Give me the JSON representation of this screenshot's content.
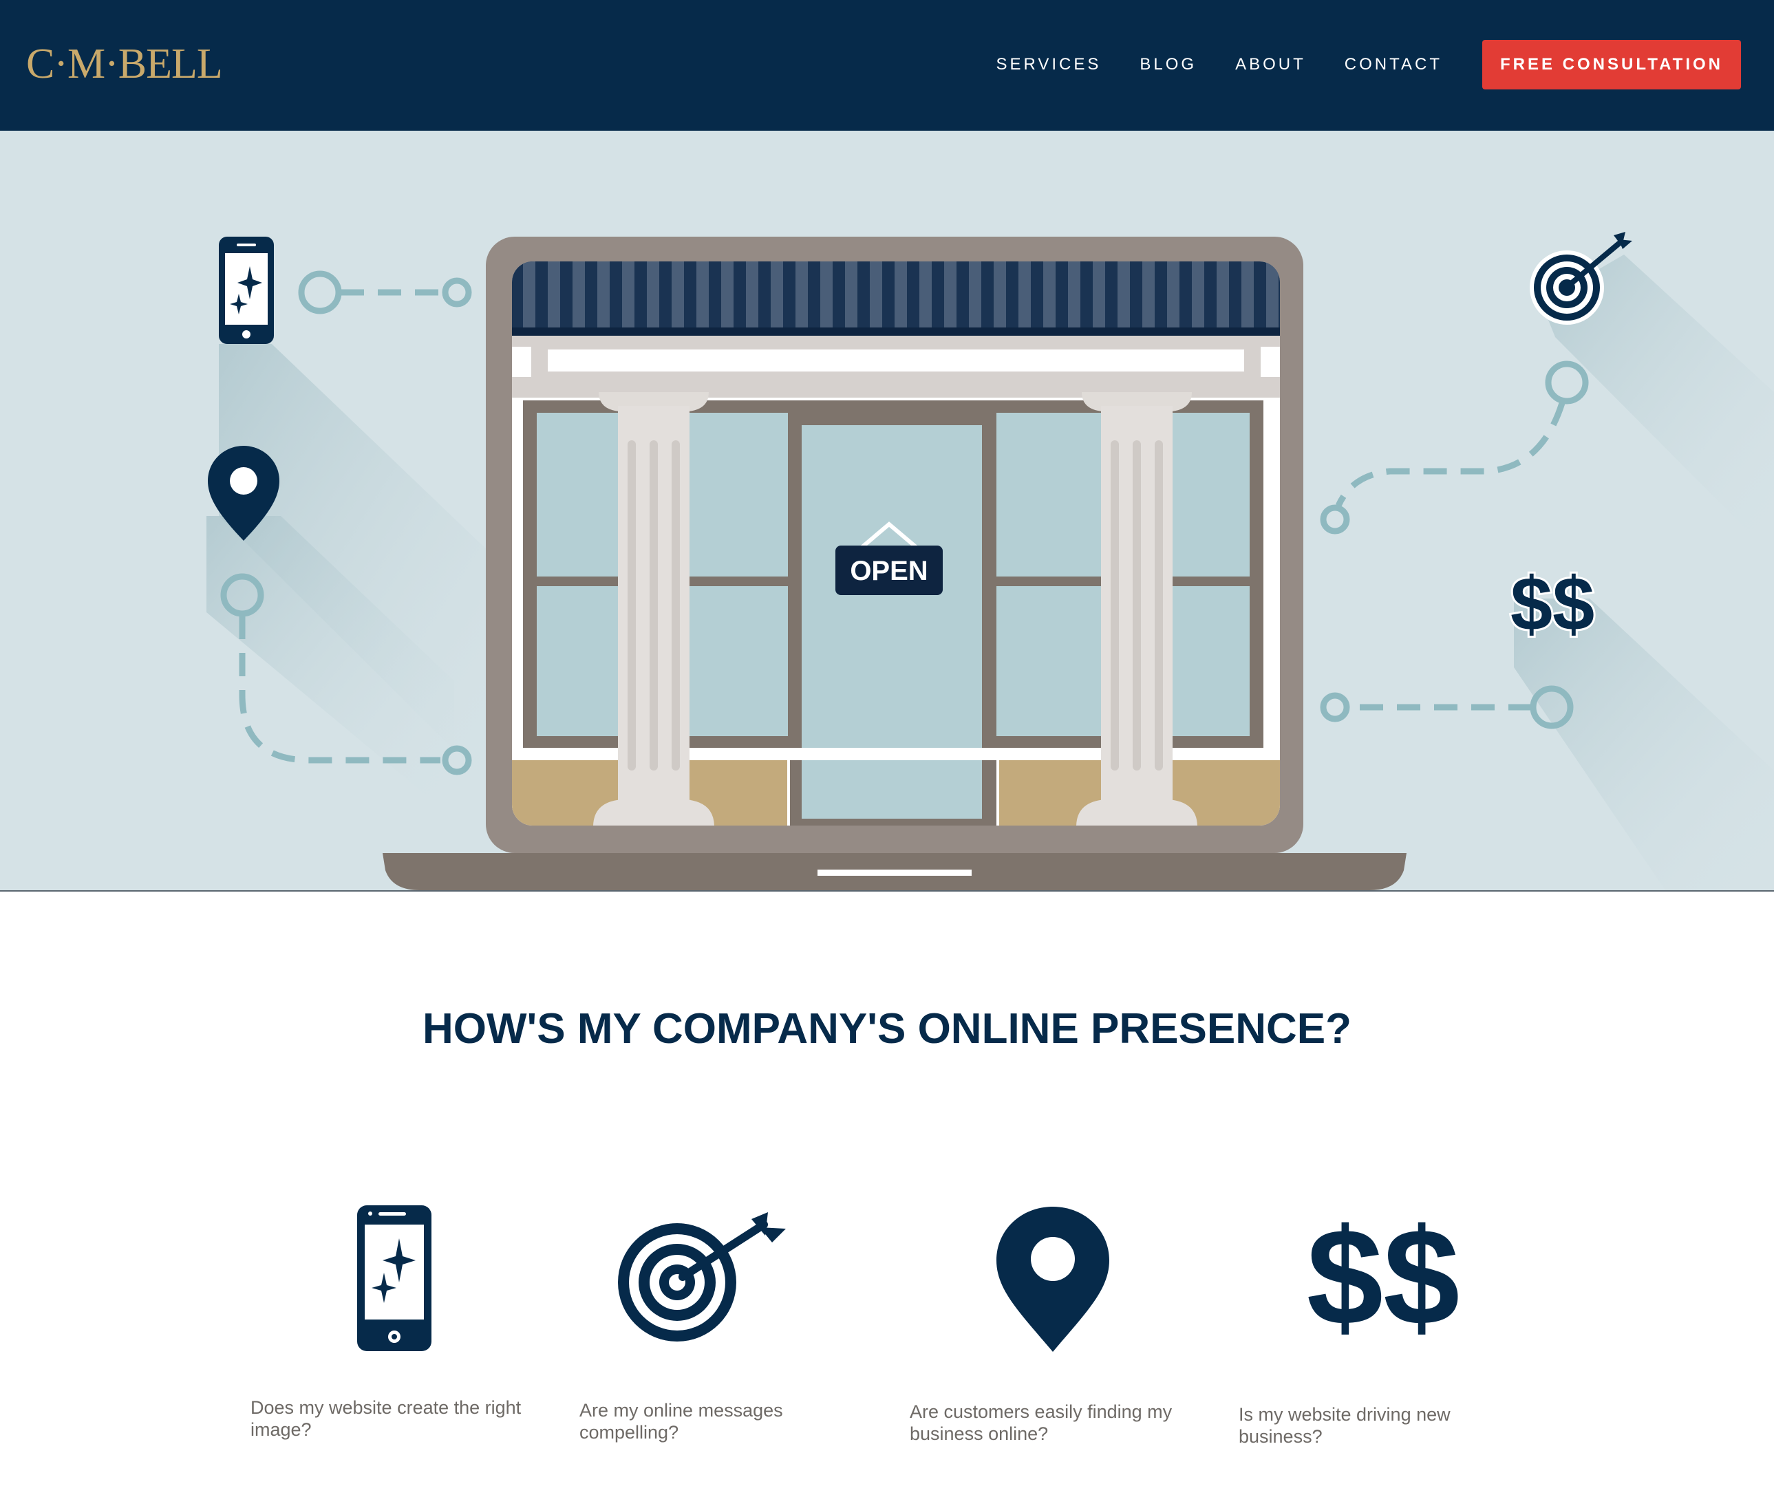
{
  "header": {
    "logo": "C·M·BELL",
    "nav": [
      {
        "label": "SERVICES"
      },
      {
        "label": "BLOG"
      },
      {
        "label": "ABOUT"
      },
      {
        "label": "CONTACT"
      }
    ],
    "cta_label": "FREE CONSULTATION"
  },
  "hero": {
    "sign_text": "OPEN",
    "money_text": "$$"
  },
  "section": {
    "title": "HOW'S MY COMPANY'S ONLINE PRESENCE?",
    "features": [
      {
        "icon": "smartphone-sparkle-icon",
        "question": "Does my website create the right image?"
      },
      {
        "icon": "target-arrow-icon",
        "question": "Are my online messages compelling?"
      },
      {
        "icon": "location-pin-icon",
        "question": "Are customers easily finding my business online?"
      },
      {
        "icon": "dollar-signs-icon",
        "text": "$$",
        "question": "Is my website driving new business?"
      }
    ]
  },
  "colors": {
    "navy": "#062a4a",
    "gold": "#c9a96b",
    "cta_red": "#e23c35",
    "hero_bg": "#d5e2e6",
    "path_teal": "#8fb9c0",
    "body_text": "#6e6a66"
  }
}
